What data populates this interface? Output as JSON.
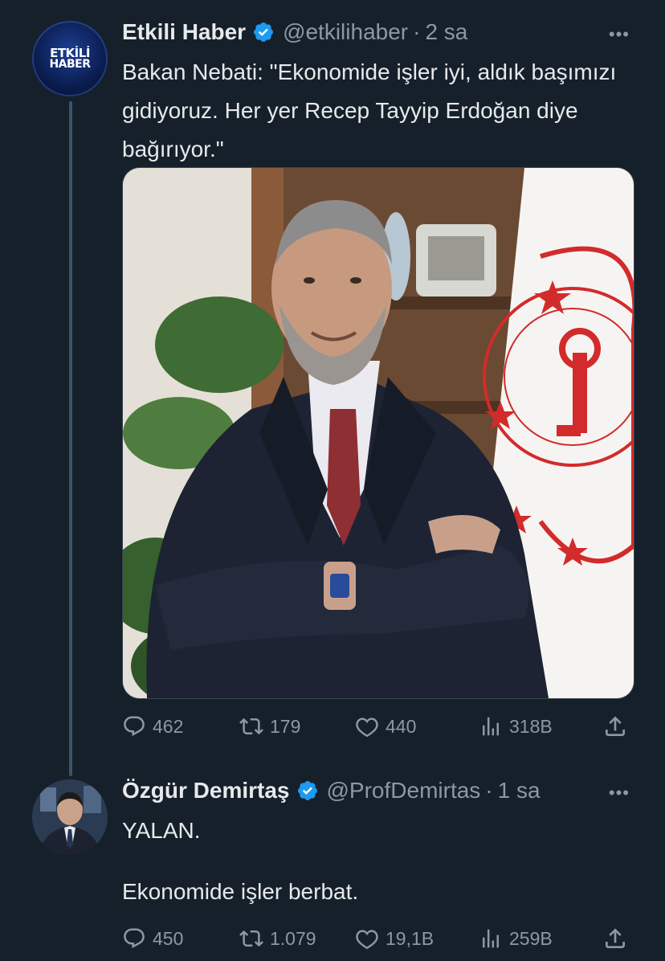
{
  "tweets": [
    {
      "author_name": "Etkili Haber",
      "author_handle": "@etkilihaber",
      "separator": "·",
      "time": "2 sa",
      "avatar_logo_top": "ETKİLİ",
      "avatar_logo_bottom": "HABER",
      "text": "Bakan Nebati: \"Ekonomide işler iyi, aldık başımızı gidiyoruz. Her yer Recep Tayyip Erdoğan diye bağırıyor.\"",
      "media_icon": "photo-of-man-in-suit-with-flag",
      "stats": {
        "replies": "462",
        "retweets": "179",
        "likes": "440",
        "views": "318B"
      }
    },
    {
      "author_name": "Özgür Demirtaş",
      "author_handle": "@ProfDemirtas",
      "separator": "·",
      "time": "1 sa",
      "text_line1": "YALAN.",
      "text_line2": "Ekonomide işler berbat.",
      "stats": {
        "replies": "450",
        "retweets": "1.079",
        "likes": "19,1B",
        "views": "259B"
      }
    }
  ],
  "more_label": "•••",
  "colors": {
    "background": "#15202b",
    "text": "#e7e9ea",
    "muted": "#8b98a5",
    "verified": "#1d9bf0",
    "thread_line": "#3d5466"
  },
  "icons": [
    "verified-badge-icon",
    "reply-icon",
    "retweet-icon",
    "like-icon",
    "views-icon",
    "share-icon",
    "more-icon"
  ]
}
